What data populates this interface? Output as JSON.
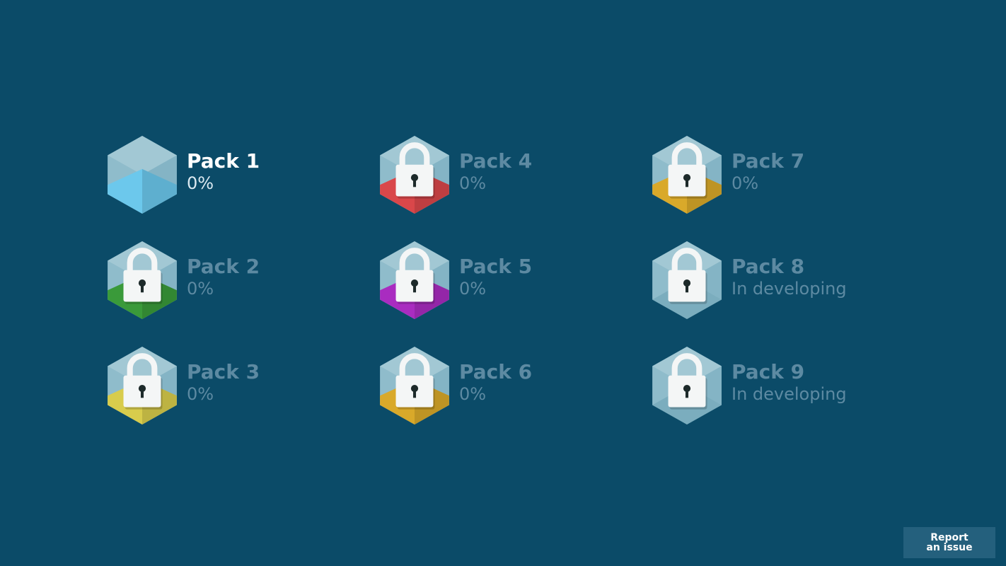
{
  "packs": [
    {
      "title": "Pack 1",
      "status": "0%",
      "locked": false,
      "color": "#6cc8ec"
    },
    {
      "title": "Pack 2",
      "status": "0%",
      "locked": true,
      "color": "#3a9a3a"
    },
    {
      "title": "Pack 3",
      "status": "0%",
      "locked": true,
      "color": "#d8cc4c"
    },
    {
      "title": "Pack 4",
      "status": "0%",
      "locked": true,
      "color": "#d9474a"
    },
    {
      "title": "Pack 5",
      "status": "0%",
      "locked": true,
      "color": "#a92cc0"
    },
    {
      "title": "Pack 6",
      "status": "0%",
      "locked": true,
      "color": "#d9a92a"
    },
    {
      "title": "Pack 7",
      "status": "0%",
      "locked": true,
      "color": "#d9a92a"
    },
    {
      "title": "Pack 8",
      "status": "In developing",
      "locked": true,
      "color": null
    },
    {
      "title": "Pack 9",
      "status": "In developing",
      "locked": true,
      "color": null
    }
  ],
  "report_button": {
    "line1": "Report",
    "line2": "an issue"
  }
}
